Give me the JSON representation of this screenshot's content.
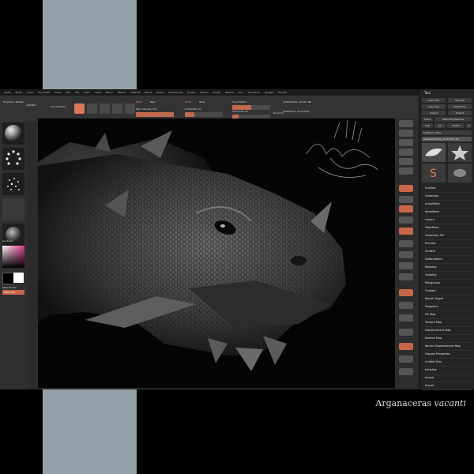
{
  "menu": {
    "items": [
      "Alpha",
      "Brush",
      "Color",
      "Document",
      "Draw",
      "Edit",
      "File",
      "Layer",
      "Light",
      "Macro",
      "Marker",
      "Material",
      "Movie",
      "Picker",
      "Preferences",
      "Render",
      "Stencil",
      "Stroke",
      "Texture",
      "Tool",
      "Transform",
      "Zplugin",
      "Zscript"
    ]
  },
  "topbar": {
    "projection_label": "Projection Master",
    "lightbox_label": "LightBox",
    "quicksketch_label": "Quick Sketch",
    "mrgb_label": "Mrgb",
    "rgb_label": "Rgb",
    "rgb_intensity": "Rgb Intensity 100",
    "zadd_label": "Zadd",
    "zsub_label": "Zsub",
    "z_intensity": "Z Intensity 24",
    "focal_shift": "Focal Shift 0",
    "draw_size": "Draw Size 19",
    "dynamic_label": "Dynamic",
    "active_points": "ActivePoints: 19.001 Mil",
    "total_points": "TotalPoints: 19.253 Mil"
  },
  "leftshelf": {
    "gradient_label": "Gradient",
    "switch_color_label": "SwitchColor",
    "alternate_label": "Alternate"
  },
  "panel": {
    "title": "Tool",
    "buttons": [
      "Load Tool",
      "Save As",
      "Copy Tool",
      "Paste Tool",
      "Import",
      "Export",
      "Clone",
      "Make PolyMesh3D",
      "GoZ",
      "All",
      "Visible",
      "R"
    ],
    "lightbox_tools": "Lightbox› Tools",
    "current_tool": "ARGANACERAS_2019_005_48",
    "menu_items": [
      "SubTool",
      "Geometry",
      "ArrayMesh",
      "NanoMesh",
      "Layers",
      "FiberMesh",
      "Geometry HD",
      "Preview",
      "Surface",
      "Deformation",
      "Masking",
      "Visibility",
      "Polygroups",
      "Contact",
      "Morph Target",
      "Polypaint",
      "UV Map",
      "Texture Map",
      "Displacement Map",
      "Normal Map",
      "Vector Displacement Map",
      "Display Properties",
      "Unified Skin",
      "Initialize",
      "Import",
      "Export"
    ]
  },
  "caption": {
    "genus": "Arganaceras",
    "species": "vacanti"
  }
}
